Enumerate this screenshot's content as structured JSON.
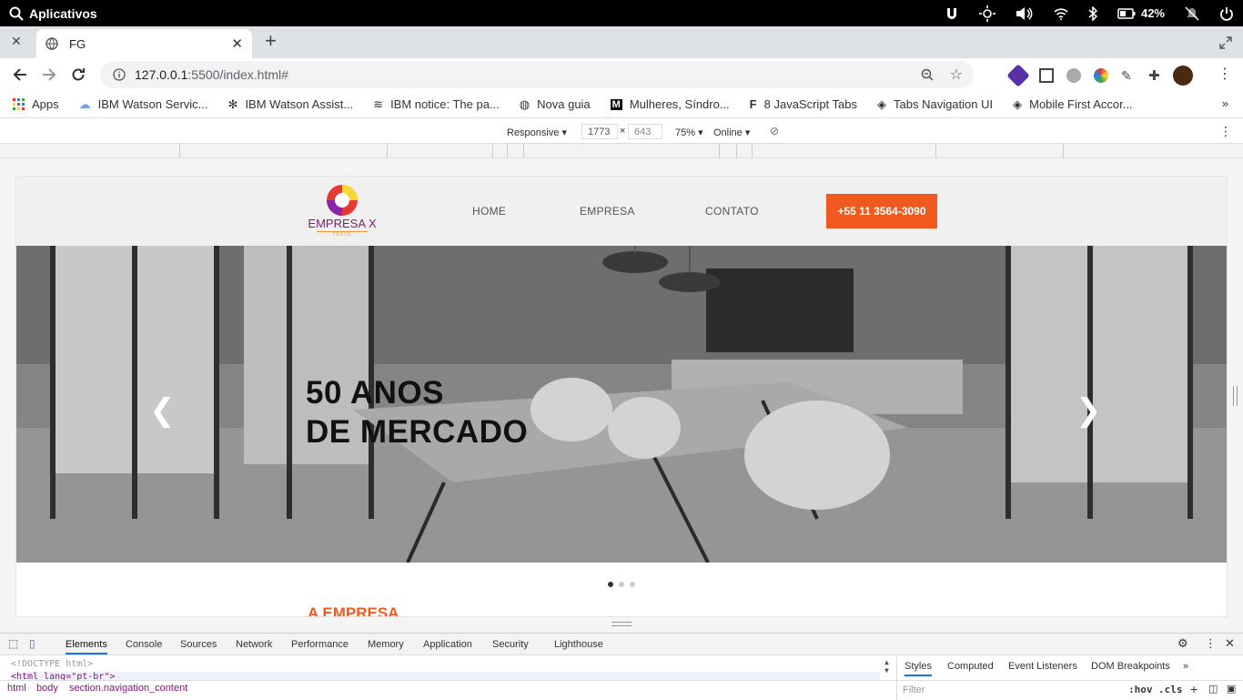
{
  "os": {
    "app_label": "Aplicativos",
    "battery": "42%"
  },
  "tab": {
    "title": "FG"
  },
  "address": {
    "host": "127.0.0.1",
    "path": ":5500/index.html#"
  },
  "bookmarks": [
    {
      "label": "Apps",
      "icon": "apps-grid-icon"
    },
    {
      "label": "IBM Watson Servic...",
      "icon": "cloud-icon"
    },
    {
      "label": "IBM Watson Assist...",
      "icon": "bee-icon"
    },
    {
      "label": "IBM notice: The pa...",
      "icon": "ibm-icon"
    },
    {
      "label": "Nova guia",
      "icon": "globe-icon"
    },
    {
      "label": "Mulheres, Síndro...",
      "icon": "medium-icon"
    },
    {
      "label": "8 JavaScript Tabs",
      "icon": "f-icon"
    },
    {
      "label": "Tabs Navigation UI",
      "icon": "codepen-icon"
    },
    {
      "label": "Mobile First Accor...",
      "icon": "codepen-icon"
    }
  ],
  "device_toolbar": {
    "mode": "Responsive",
    "width": "1773",
    "height": "643",
    "zoom": "75%",
    "throttle": "Online"
  },
  "site": {
    "logo_text": "EMPRESA X",
    "logo_sub": "TESTE",
    "nav": [
      "HOME",
      "EMPRESA",
      "CONTATO"
    ],
    "phone": "+55 11 3564-3090",
    "hero_line1": "50 ANOS",
    "hero_line2": "DE MERCADO",
    "section_title": "A EMPRESA",
    "carousel_active": 1,
    "carousel_total": 3
  },
  "devtools": {
    "tabs": [
      "Elements",
      "Console",
      "Sources",
      "Network",
      "Performance",
      "Memory",
      "Application",
      "Security",
      "Lighthouse"
    ],
    "code_line1": "<!DOCTYPE html>",
    "code_line2": "<html lang=\"pt-br\">",
    "crumbs": [
      "html",
      "body",
      "section.navigation_content"
    ],
    "side_tabs": [
      "Styles",
      "Computed",
      "Event Listeners",
      "DOM Breakpoints"
    ],
    "filter_placeholder": "Filter",
    "hov": ":hov",
    "cls": ".cls"
  },
  "colors": {
    "accent": "#f15a1f"
  }
}
